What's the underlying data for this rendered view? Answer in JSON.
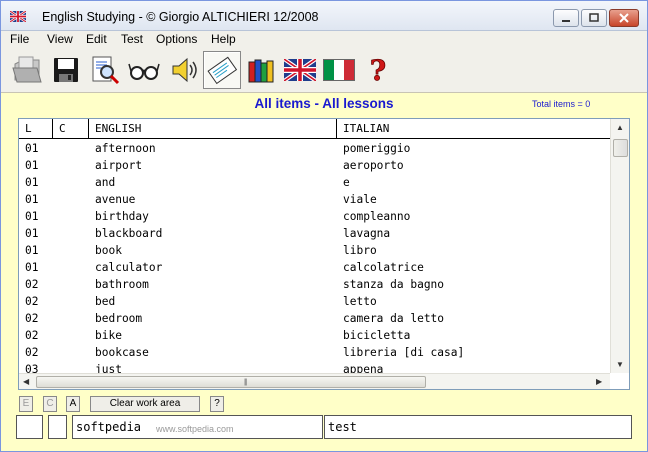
{
  "window": {
    "title": "English Studying  - © Giorgio ALTICHIERI 12/2008"
  },
  "menu": [
    "File",
    "View",
    "Edit",
    "Test",
    "Options",
    "Help"
  ],
  "toolbar": {
    "buttons": [
      {
        "icon": "open-folder-icon",
        "pressed": false
      },
      {
        "icon": "save-floppy-icon",
        "pressed": false
      },
      {
        "icon": "search-magnifier-icon",
        "pressed": false
      },
      {
        "icon": "glasses-icon",
        "pressed": false
      },
      {
        "icon": "speaker-icon",
        "pressed": false
      },
      {
        "icon": "card-icon",
        "pressed": true
      },
      {
        "icon": "books-icon",
        "pressed": false
      },
      {
        "icon": "uk-flag-icon",
        "pressed": false
      },
      {
        "icon": "italy-flag-icon",
        "pressed": false
      },
      {
        "icon": "help-question-icon",
        "pressed": false
      }
    ]
  },
  "header": {
    "view_title": "All items - All lessons",
    "total_items": "Total items = 0"
  },
  "grid": {
    "columns": [
      "L",
      "C",
      "ENGLISH",
      "ITALIAN"
    ],
    "rows": [
      [
        "01",
        "",
        "afternoon",
        "pomeriggio"
      ],
      [
        "01",
        "",
        "airport",
        "aeroporto"
      ],
      [
        "01",
        "",
        "and",
        "e"
      ],
      [
        "01",
        "",
        "avenue",
        "viale"
      ],
      [
        "01",
        "",
        "birthday",
        "compleanno"
      ],
      [
        "01",
        "",
        "blackboard",
        "lavagna"
      ],
      [
        "01",
        "",
        "book",
        "libro"
      ],
      [
        "01",
        "",
        "calculator",
        "calcolatrice"
      ],
      [
        "02",
        "",
        "bathroom",
        "stanza da bagno"
      ],
      [
        "02",
        "",
        "bed",
        "letto"
      ],
      [
        "02",
        "",
        "bedroom",
        "camera da letto"
      ],
      [
        "02",
        "",
        "bike",
        "bicicletta"
      ],
      [
        "02",
        "",
        "bookcase",
        "libreria [di casa]"
      ],
      [
        "03",
        "",
        "just",
        "appena"
      ]
    ]
  },
  "bottom": {
    "buttons": {
      "e": "E",
      "c": "C",
      "a": "A",
      "clear": "Clear work area",
      "help": "?"
    },
    "fields": {
      "l": "",
      "c": "",
      "english": "softpedia",
      "italian": "test"
    },
    "watermark": "www.softpedia.com"
  },
  "colors": {
    "panel": "#ffffc8",
    "title_blue": "#1a1ad0",
    "chrome": "#f1f0ea"
  }
}
